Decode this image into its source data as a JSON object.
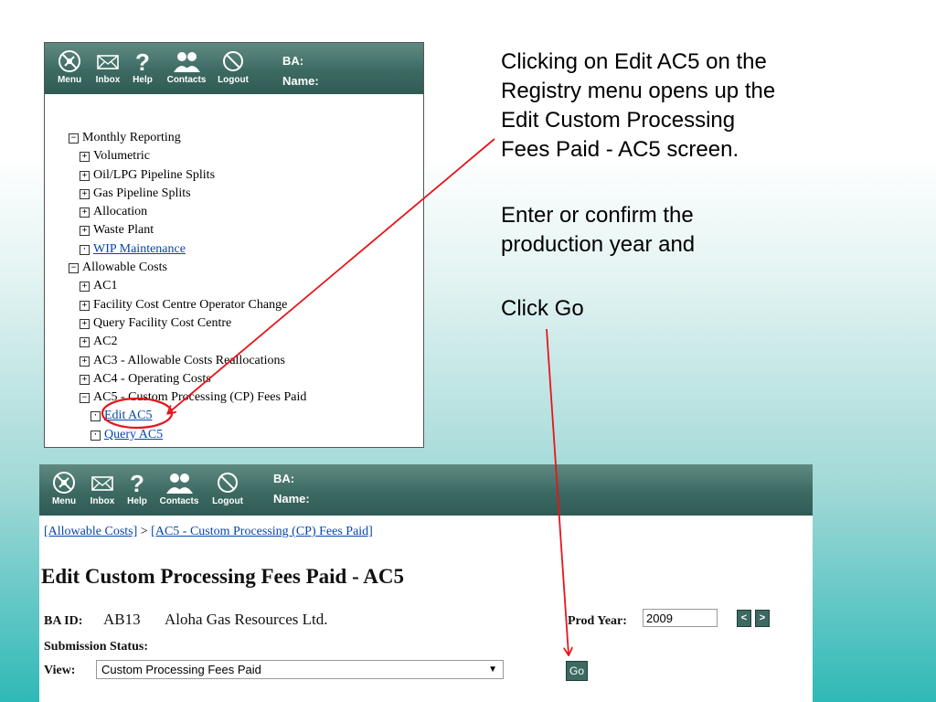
{
  "toolbar": {
    "buttons": [
      {
        "label": "Menu",
        "icon": "menu-compass-icon"
      },
      {
        "label": "Inbox",
        "icon": "envelope-icon"
      },
      {
        "label": "Help",
        "icon": "question-mark-icon"
      },
      {
        "label": "Contacts",
        "icon": "people-icon"
      },
      {
        "label": "Logout",
        "icon": "no-entry-icon"
      }
    ],
    "ba_label": "BA:",
    "name_label_top": "Name:",
    "name_label": "Name:",
    "color": "#3c6a62"
  },
  "tree": [
    {
      "label": "Monthly Reporting",
      "state": "expanded",
      "level": 0,
      "link": false
    },
    {
      "label": "Volumetric",
      "state": "collapsed",
      "level": 1,
      "link": false
    },
    {
      "label": "Oil/LPG Pipeline Splits",
      "state": "collapsed",
      "level": 1,
      "link": false
    },
    {
      "label": "Gas Pipeline Splits",
      "state": "collapsed",
      "level": 1,
      "link": false
    },
    {
      "label": "Allocation",
      "state": "collapsed",
      "level": 1,
      "link": false
    },
    {
      "label": "Waste Plant",
      "state": "collapsed",
      "level": 1,
      "link": false
    },
    {
      "label": "WIP Maintenance",
      "state": "leaf",
      "level": 1,
      "link": true
    },
    {
      "label": "Allowable Costs",
      "state": "expanded",
      "level": 0,
      "link": false
    },
    {
      "label": "AC1",
      "state": "collapsed",
      "level": 1,
      "link": false
    },
    {
      "label": "Facility Cost Centre Operator Change",
      "state": "collapsed",
      "level": 1,
      "link": false
    },
    {
      "label": "Query Facility Cost Centre",
      "state": "collapsed",
      "level": 1,
      "link": false
    },
    {
      "label": "AC2",
      "state": "collapsed",
      "level": 1,
      "link": false
    },
    {
      "label": "AC3 - Allowable Costs Reallocations",
      "state": "collapsed",
      "level": 1,
      "link": false
    },
    {
      "label": "AC4 - Operating Costs",
      "state": "collapsed",
      "level": 1,
      "link": false
    },
    {
      "label": "AC5 - Custom Processing (CP) Fees Paid",
      "state": "expanded",
      "level": 1,
      "link": false
    },
    {
      "label": "Edit AC5",
      "state": "leaf",
      "level": 2,
      "link": true
    },
    {
      "label": "Query AC5",
      "state": "leaf",
      "level": 2,
      "link": true
    }
  ],
  "edit": {
    "breadcrumb_1": "[Allowable Costs]",
    "breadcrumb_sep": " > ",
    "breadcrumb_2": "[AC5 - Custom Processing (CP) Fees Paid]",
    "title": "Edit Custom Processing Fees Paid - AC5",
    "ba_id_label": "BA ID:",
    "ba_id": "AB13",
    "company": "Aloha Gas Resources Ltd.",
    "prod_year_label": "Prod Year:",
    "prod_year": "2009",
    "prev_label": "<",
    "next_label": ">",
    "submission_status_label": "Submission Status:",
    "view_label": "View:",
    "view_value": "Custom Processing Fees Paid",
    "go_label": "Go"
  },
  "notes": {
    "line1": "Clicking on Edit AC5 on the",
    "line2": "Registry menu opens up the",
    "line3": "Edit Custom Processing",
    "line4": "Fees Paid - AC5 screen.",
    "line5": "Enter or confirm the",
    "line6": "production year and",
    "line7": "Click Go"
  },
  "colors": {
    "annotation": "#e8141b",
    "link": "#0645ad",
    "toolbar": "#3c6a62"
  }
}
